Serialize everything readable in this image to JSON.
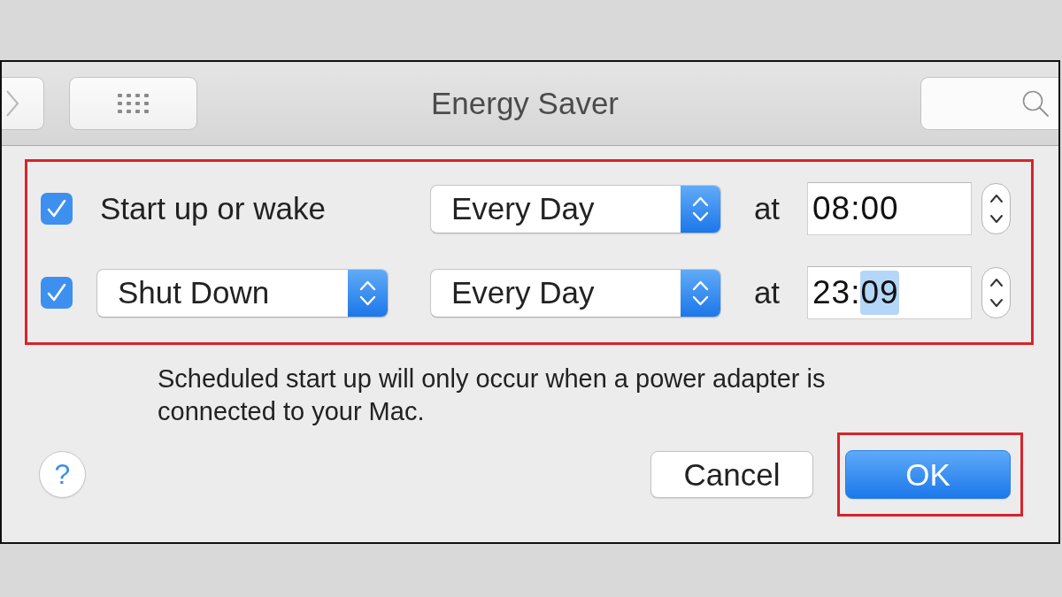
{
  "window": {
    "title": "Energy Saver"
  },
  "schedule": {
    "highlighted": true,
    "rows": [
      {
        "kind": "label",
        "checked": true,
        "event": "Start up or wake",
        "days": "Every Day",
        "at": "at",
        "time": {
          "separator": ":",
          "segments": [
            {
              "text": "08",
              "selected": false
            },
            {
              "text": "00",
              "selected": false
            }
          ]
        }
      },
      {
        "kind": "popup",
        "checked": true,
        "event": "Shut Down",
        "days": "Every Day",
        "at": "at",
        "time": {
          "separator": ":",
          "segments": [
            {
              "text": "23",
              "selected": false
            },
            {
              "text": "09",
              "selected": true
            }
          ]
        }
      }
    ]
  },
  "note": "Scheduled start up will only occur when a power adapter is connected to your Mac.",
  "help": "?",
  "buttons": [
    {
      "label": "Cancel",
      "kind": "default",
      "highlighted": false
    },
    {
      "label": "OK",
      "kind": "primary",
      "highlighted": true
    }
  ]
}
